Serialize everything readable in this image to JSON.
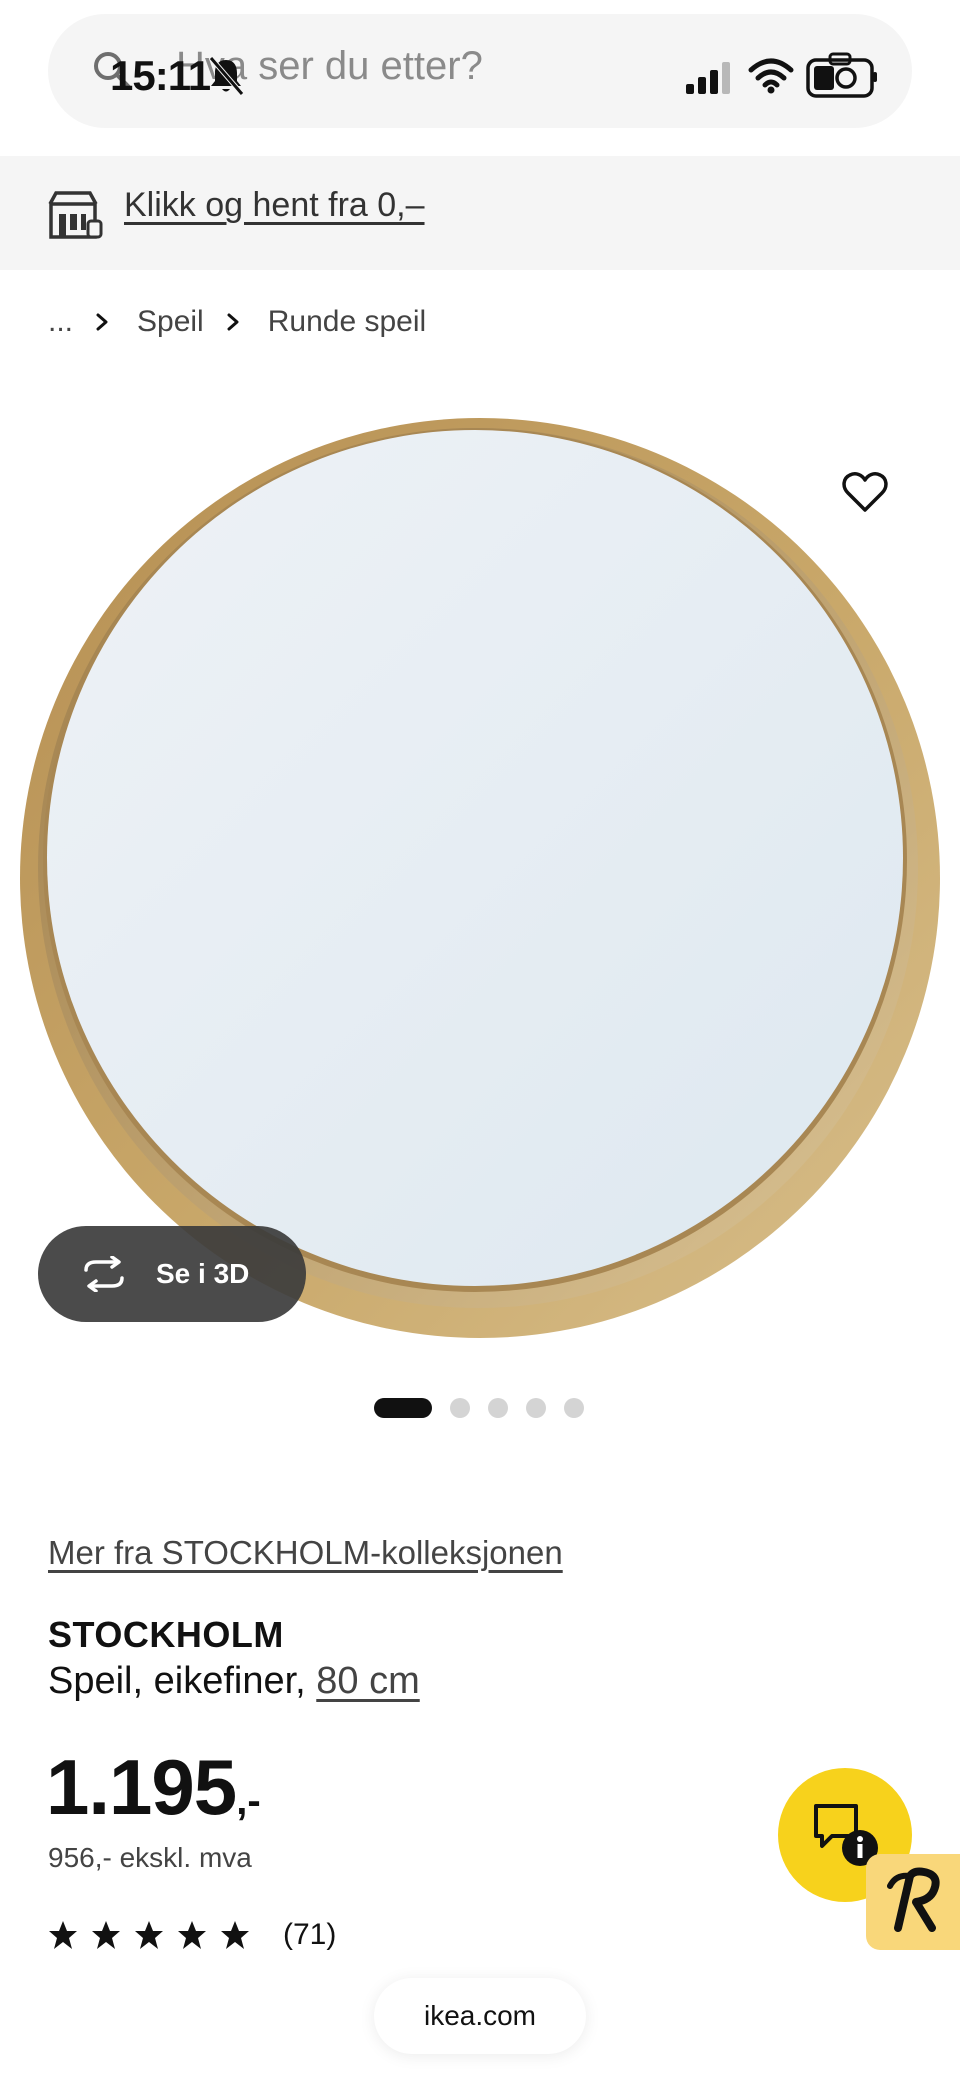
{
  "status_bar": {
    "time": "15:11"
  },
  "search": {
    "placeholder": "Hva ser du etter?"
  },
  "banner": {
    "link_text": "Klikk og hent fra 0,–"
  },
  "breadcrumb": {
    "items": [
      "...",
      "Speil",
      "Runde speil"
    ]
  },
  "gallery": {
    "view_3d_label": "Se i 3D",
    "image_count": 5,
    "active_index": 0
  },
  "product": {
    "collection_link": "Mer fra STOCKHOLM-kolleksjonen",
    "name": "STOCKHOLM",
    "description": "Speil, eikefiner, ",
    "size": "80 cm",
    "price_integer": "1.195",
    "price_suffix": ",-",
    "price_ex_vat": "956,- ekskl. mva",
    "rating_stars": 5,
    "rating_count": "(71)"
  },
  "browser": {
    "domain": "ikea.com"
  },
  "colors": {
    "accent_yellow": "#f7d21c",
    "badge_yellow": "#f9d77a",
    "frame_oak": "#c9a86a",
    "dark_button": "#3c3c3c"
  },
  "icons": [
    "search-icon",
    "bell-muted-icon",
    "signal-icon",
    "wifi-icon",
    "camera-icon",
    "store-icon",
    "chevron-right-icon",
    "heart-icon",
    "rotate-3d-icon",
    "star-icon",
    "chat-info-icon",
    "r-logo-icon"
  ]
}
